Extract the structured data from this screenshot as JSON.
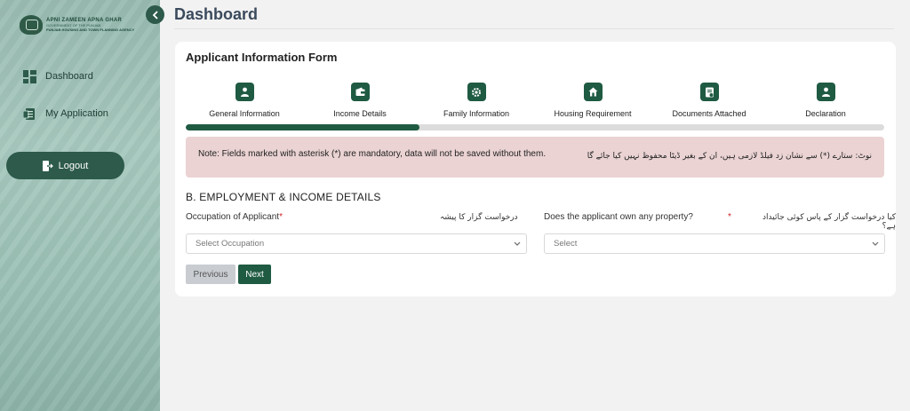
{
  "logo": {
    "line1": "APNI ZAMEEN APNA GHAR",
    "line2": "GOVERNMENT OF THE PUNJAB",
    "line3": "PUNJAB HOUSING AND TOWN PLANNING AGENCY"
  },
  "sidebar": {
    "items": [
      {
        "label": "Dashboard",
        "icon": "dashboard-grid-icon"
      },
      {
        "label": "My Application",
        "icon": "document-icon"
      }
    ],
    "logout_label": "Logout"
  },
  "header": {
    "title": "Dashboard"
  },
  "form": {
    "title": "Applicant Information Form",
    "steps": [
      {
        "label": "General Information",
        "icon": "user-icon"
      },
      {
        "label": "Income Details",
        "icon": "wallet-icon"
      },
      {
        "label": "Family Information",
        "icon": "gear-badge-icon"
      },
      {
        "label": "Housing Requirement",
        "icon": "home-icon"
      },
      {
        "label": "Documents Attached",
        "icon": "document-check-icon"
      },
      {
        "label": "Declaration",
        "icon": "user-icon"
      }
    ],
    "progress": 0.335,
    "note_en": "Note: Fields marked with asterisk (*) are mandatory, data will not be saved without them.",
    "note_ur": "نوٹ: ستارے (*) سے نشان زد فیلڈ لازمی ہیں، ان کے بغیر ڈیٹا محفوظ نہیں کیا جائے گا",
    "section_title": "B. EMPLOYMENT & INCOME DETAILS",
    "occupation": {
      "label": "Occupation of Applicant",
      "required_mark": "*",
      "urdu_label": "درخواست گزار کا پیشہ",
      "selected": "Select Occupation"
    },
    "property": {
      "label": "Does the applicant own any property?",
      "required_mark": "*",
      "urdu_label": "کیا درخواست گزار کے پاس کوئی جائیداد ہے؟",
      "selected": "Select"
    },
    "previous_label": "Previous",
    "next_label": "Next"
  },
  "colors": {
    "primary": "#1f5a43",
    "sidebar_button": "#2d5a4a",
    "note_background": "#ebd3d3",
    "required": "#d02222"
  }
}
